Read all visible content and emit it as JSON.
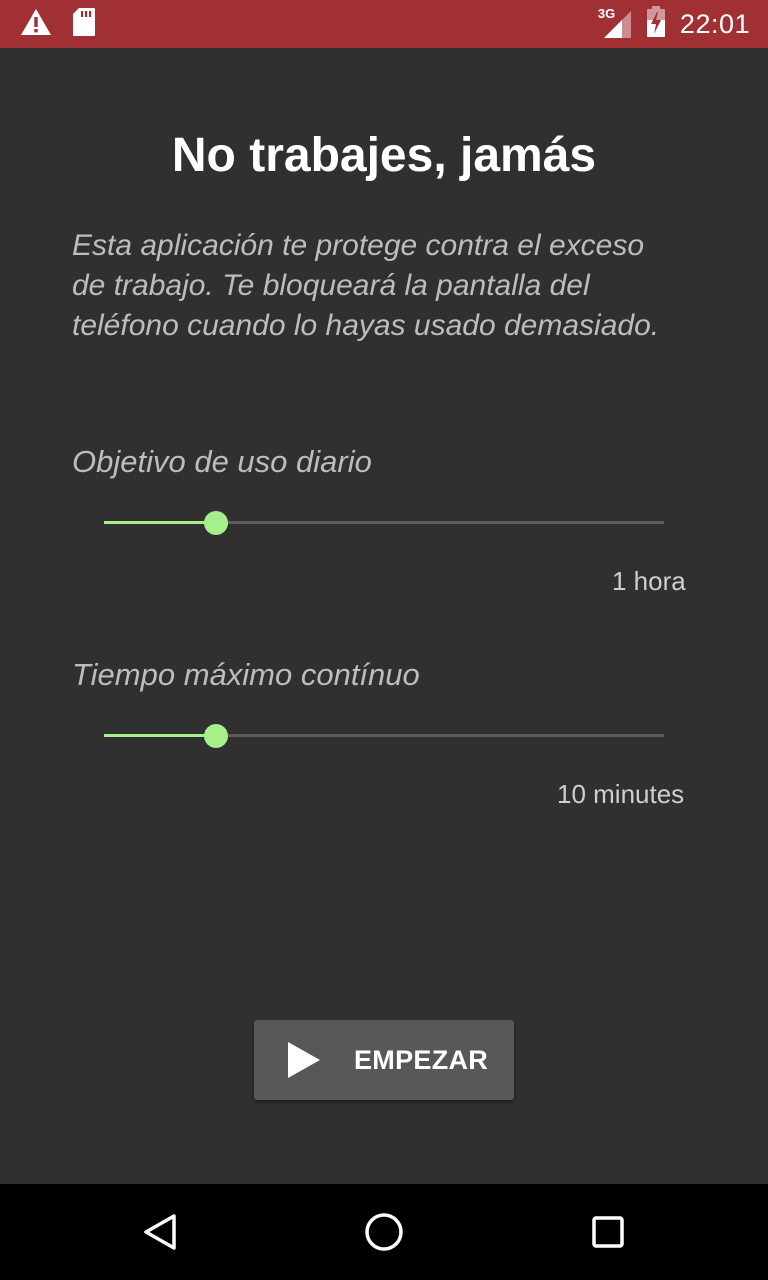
{
  "status_bar": {
    "time": "22:01",
    "network_type": "3G",
    "left_icons": [
      "warning-icon",
      "sd-card-icon"
    ],
    "right_icons": [
      "signal-icon",
      "battery-icon"
    ],
    "background_color": "#a13035"
  },
  "main": {
    "title": "No trabajes, jamás",
    "description": "Esta aplicación te protege contra el exceso de trabajo. Te bloqueará la pantalla del teléfono cuando lo hayas usado demasiado.",
    "daily_goal": {
      "label": "Objetivo de uso diario",
      "value_text": "1 hora",
      "slider_fraction": 0.2
    },
    "max_continuous": {
      "label": "Tiempo máximo contínuo",
      "value_text": "10 minutes",
      "slider_fraction": 0.2
    },
    "start_button": {
      "label": "EMPEZAR",
      "icon": "play-icon"
    },
    "accent_color": "#a6f08c"
  },
  "nav_bar": {
    "buttons": [
      "back-icon",
      "home-icon",
      "recents-icon"
    ]
  }
}
